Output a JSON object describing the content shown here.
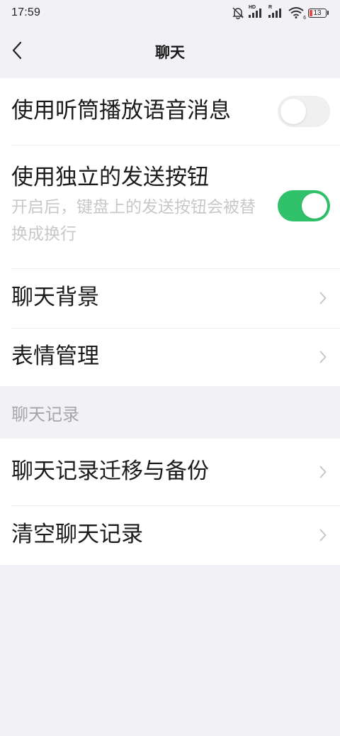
{
  "status_bar": {
    "time": "17:59",
    "network_1": "HD",
    "network_2": "R",
    "wifi_label": "6",
    "battery": "13",
    "icons": [
      "mute-bell-icon",
      "signal-icon",
      "signal-icon",
      "wifi-icon",
      "battery-icon"
    ]
  },
  "nav": {
    "title": "聊天",
    "back_icon": "chevron-left-icon"
  },
  "settings": {
    "earpiece": {
      "label": "使用听筒播放语音消息",
      "enabled": false
    },
    "send_button": {
      "label": "使用独立的发送按钮",
      "description": "开启后，键盘上的发送按钮会被替换成换行",
      "enabled": true
    },
    "chat_background": {
      "label": "聊天背景"
    },
    "sticker_management": {
      "label": "表情管理"
    }
  },
  "history": {
    "section_title": "聊天记录",
    "migrate_backup": {
      "label": "聊天记录迁移与备份"
    },
    "clear": {
      "label": "清空聊天记录"
    }
  },
  "colors": {
    "accent": "#30c26a",
    "background": "#f2f2f6",
    "battery_low": "#e64848"
  }
}
